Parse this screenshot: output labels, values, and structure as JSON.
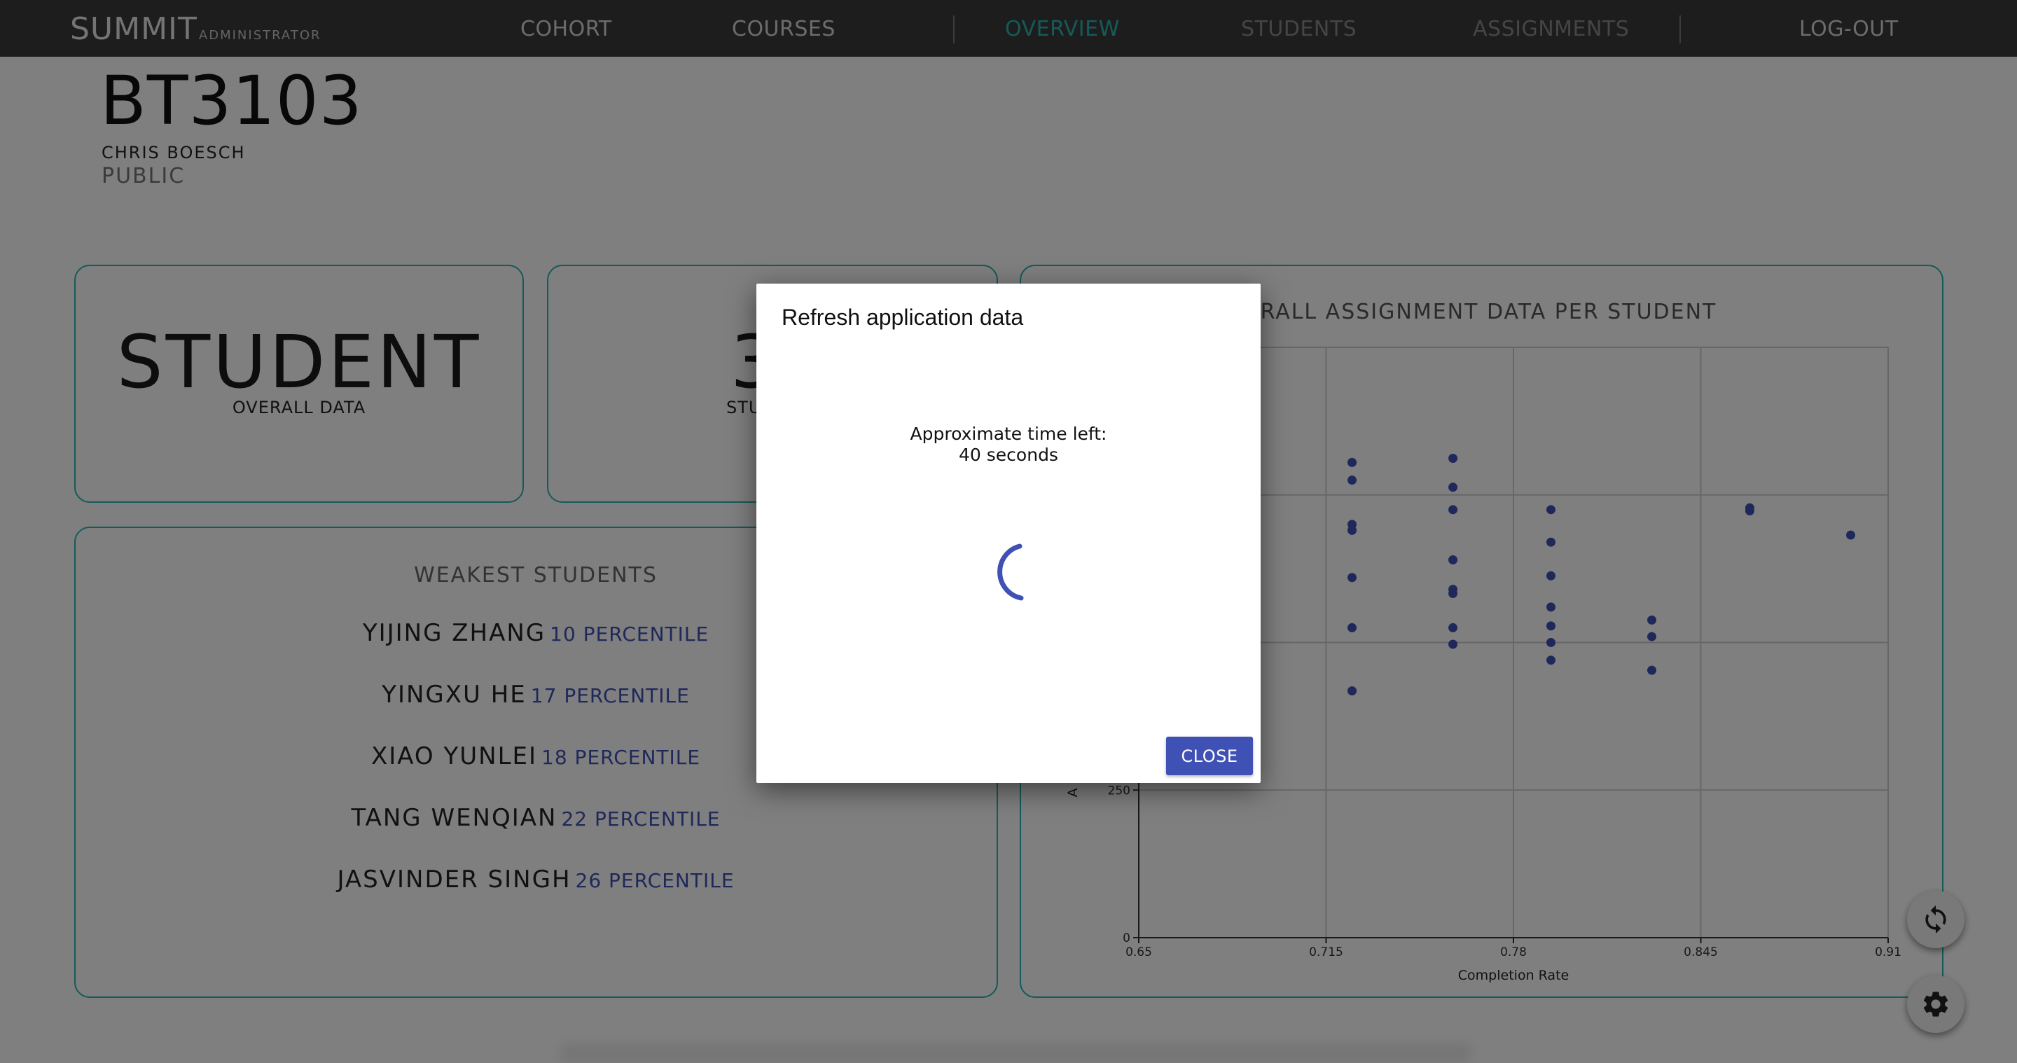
{
  "nav": {
    "brand": "SUMMIT",
    "brand_sub": "ADMINISTRATOR",
    "links": [
      "COHORT",
      "COURSES",
      "OVERVIEW",
      "STUDENTS",
      "ASSIGNMENTS",
      "LOG-OUT"
    ],
    "active": "OVERVIEW"
  },
  "course": {
    "code": "BT3103",
    "instructor": "CHRIS BOESCH",
    "visibility": "PUBLIC"
  },
  "cards": {
    "student_big": "STUDENT",
    "student_label": "OVERALL DATA",
    "mid_big": "3",
    "mid_label": "STU"
  },
  "weakest": {
    "title": "WEAKEST STUDENTS",
    "students": [
      {
        "name": "YIJING ZHANG",
        "percentile": "10 PERCENTILE"
      },
      {
        "name": "YINGXU HE",
        "percentile": "17 PERCENTILE"
      },
      {
        "name": "XIAO YUNLEI",
        "percentile": "18 PERCENTILE"
      },
      {
        "name": "TANG WENQIAN",
        "percentile": "22 PERCENTILE"
      },
      {
        "name": "JASVINDER SINGH",
        "percentile": "26 PERCENTILE"
      }
    ]
  },
  "chart_data": {
    "type": "scatter",
    "title": "ERALL ASSIGNMENT DATA PER STUDENT",
    "xlabel": "Completion Rate",
    "ylabel": "A",
    "x_ticks": [
      "0.65",
      "0.715",
      "0.78",
      "0.845",
      "0.91"
    ],
    "y_ticks": [
      "0",
      "250"
    ],
    "xlim": [
      0.65,
      0.91
    ],
    "ylim": [
      0,
      1000
    ],
    "grid": true,
    "color": "#3f51b5",
    "points": [
      {
        "x": 0.724,
        "y": 805
      },
      {
        "x": 0.724,
        "y": 775
      },
      {
        "x": 0.724,
        "y": 700
      },
      {
        "x": 0.724,
        "y": 690
      },
      {
        "x": 0.724,
        "y": 610
      },
      {
        "x": 0.724,
        "y": 525
      },
      {
        "x": 0.724,
        "y": 418
      },
      {
        "x": 0.759,
        "y": 812
      },
      {
        "x": 0.759,
        "y": 763
      },
      {
        "x": 0.759,
        "y": 725
      },
      {
        "x": 0.759,
        "y": 640
      },
      {
        "x": 0.759,
        "y": 590
      },
      {
        "x": 0.759,
        "y": 583
      },
      {
        "x": 0.759,
        "y": 525
      },
      {
        "x": 0.759,
        "y": 497
      },
      {
        "x": 0.793,
        "y": 725
      },
      {
        "x": 0.793,
        "y": 670
      },
      {
        "x": 0.793,
        "y": 613
      },
      {
        "x": 0.793,
        "y": 560
      },
      {
        "x": 0.793,
        "y": 528
      },
      {
        "x": 0.793,
        "y": 500
      },
      {
        "x": 0.793,
        "y": 470
      },
      {
        "x": 0.828,
        "y": 538
      },
      {
        "x": 0.828,
        "y": 510
      },
      {
        "x": 0.828,
        "y": 453
      },
      {
        "x": 0.862,
        "y": 728
      },
      {
        "x": 0.862,
        "y": 723
      },
      {
        "x": 0.897,
        "y": 682
      }
    ]
  },
  "dialog": {
    "title": "Refresh application data",
    "time_label": "Approximate time left:",
    "time_value": "40 seconds",
    "close_label": "CLOSE"
  },
  "icons": {
    "refresh": "refresh-icon",
    "settings": "gear-icon"
  }
}
